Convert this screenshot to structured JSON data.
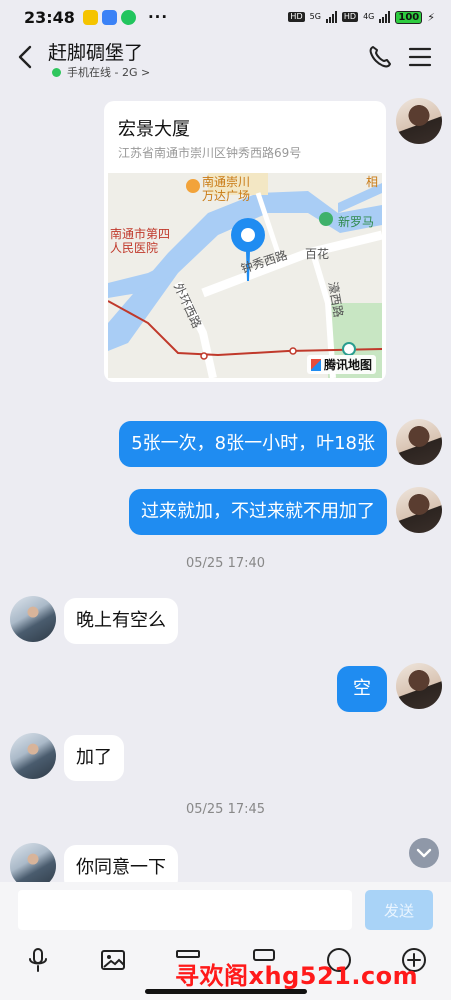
{
  "status_bar": {
    "time": "23:48",
    "more": "···",
    "hd1": "HD",
    "net1": "5G",
    "hd2": "HD",
    "net2": "4G",
    "battery": "100"
  },
  "header": {
    "contact_name": "赶脚碉堡了",
    "online_status": "手机在线 - 2G >"
  },
  "location": {
    "name": "宏景大厦",
    "address": "江苏省南通市崇川区钟秀西路69号",
    "map_labels": {
      "plaza": "南通崇川\n万达广场",
      "hospital1": "南通市第四",
      "hospital2": "人民医院",
      "road1": "钟秀西路",
      "road2": "百花",
      "road3": "外环西路",
      "road4": "濠西路",
      "xinluoma": "新罗马",
      "top_right": "相"
    },
    "map_provider": "腾讯地图"
  },
  "messages": [
    {
      "side": "out",
      "text": "5张一次，8张一小时，叶18张"
    },
    {
      "side": "out",
      "text": "过来就加，不过来就不用加了"
    },
    {
      "type": "time",
      "text": "05/25 17:40"
    },
    {
      "side": "in",
      "text": "晚上有空么"
    },
    {
      "side": "out",
      "text": "空"
    },
    {
      "side": "in",
      "text": "加了"
    },
    {
      "type": "time",
      "text": "05/25 17:45"
    },
    {
      "side": "in",
      "text": "你同意一下"
    }
  ],
  "composer": {
    "placeholder": "",
    "send_label": "发送"
  },
  "watermark": "寻欢阁xhg521.com",
  "colors": {
    "bubble_out": "#1f8cf1",
    "bubble_in": "#ffffff",
    "background": "#ececf2",
    "online": "#2fc65d"
  }
}
